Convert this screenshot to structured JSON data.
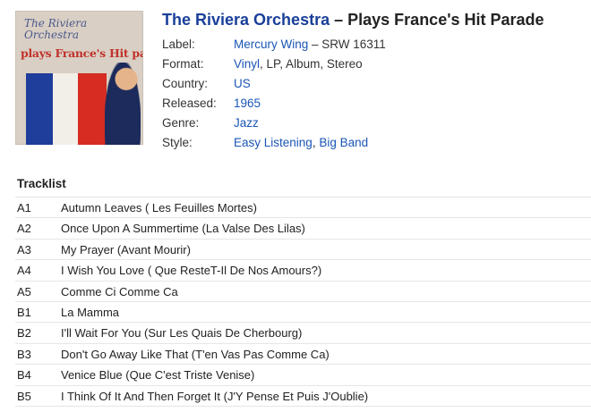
{
  "release": {
    "artist": "The Riviera Orchestra",
    "separator": "–",
    "album": "Plays France's Hit Parade",
    "cover_text": {
      "line1": "The Riviera Orchestra",
      "line2": "plays France's Hit parade"
    }
  },
  "details": [
    {
      "key": "Label:",
      "values": [
        {
          "text": "Mercury Wing",
          "link": true
        },
        {
          "text": " – SRW 16311",
          "link": false
        }
      ]
    },
    {
      "key": "Format:",
      "values": [
        {
          "text": "Vinyl",
          "link": true
        },
        {
          "text": ", LP, Album, Stereo",
          "link": false
        }
      ]
    },
    {
      "key": "Country:",
      "values": [
        {
          "text": "US",
          "link": true
        }
      ]
    },
    {
      "key": "Released:",
      "values": [
        {
          "text": "1965",
          "link": true
        }
      ]
    },
    {
      "key": "Genre:",
      "values": [
        {
          "text": "Jazz",
          "link": true
        }
      ]
    },
    {
      "key": "Style:",
      "values": [
        {
          "text": "Easy Listening",
          "link": true
        },
        {
          "text": ", ",
          "link": false
        },
        {
          "text": "Big Band",
          "link": true
        }
      ]
    }
  ],
  "tracklist": {
    "heading": "Tracklist",
    "tracks": [
      {
        "pos": "A1",
        "title": "Autumn Leaves ( Les Feuilles Mortes)"
      },
      {
        "pos": "A2",
        "title": "Once Upon A Summertime (La Valse Des Lilas)"
      },
      {
        "pos": "A3",
        "title": "My Prayer (Avant Mourir)"
      },
      {
        "pos": "A4",
        "title": "I Wish You Love ( Que ResteT-Il De Nos Amours?)"
      },
      {
        "pos": "A5",
        "title": "Comme Ci Comme Ca"
      },
      {
        "pos": "B1",
        "title": "La Mamma"
      },
      {
        "pos": "B2",
        "title": "I'll Wait For You (Sur Les Quais De Cherbourg)"
      },
      {
        "pos": "B3",
        "title": "Don't Go Away Like That (T'en Vas Pas Comme Ca)"
      },
      {
        "pos": "B4",
        "title": "Venice Blue (Que C'est Triste Venise)"
      },
      {
        "pos": "B5",
        "title": "I Think Of It And Then Forget It (J'Y Pense Et Puis J'Oublie)"
      }
    ]
  },
  "colors": {
    "artist_link": "#1a3f9a",
    "link": "#1a56b5",
    "flag_blue": "#1f3d9a",
    "flag_red": "#d62c22"
  }
}
